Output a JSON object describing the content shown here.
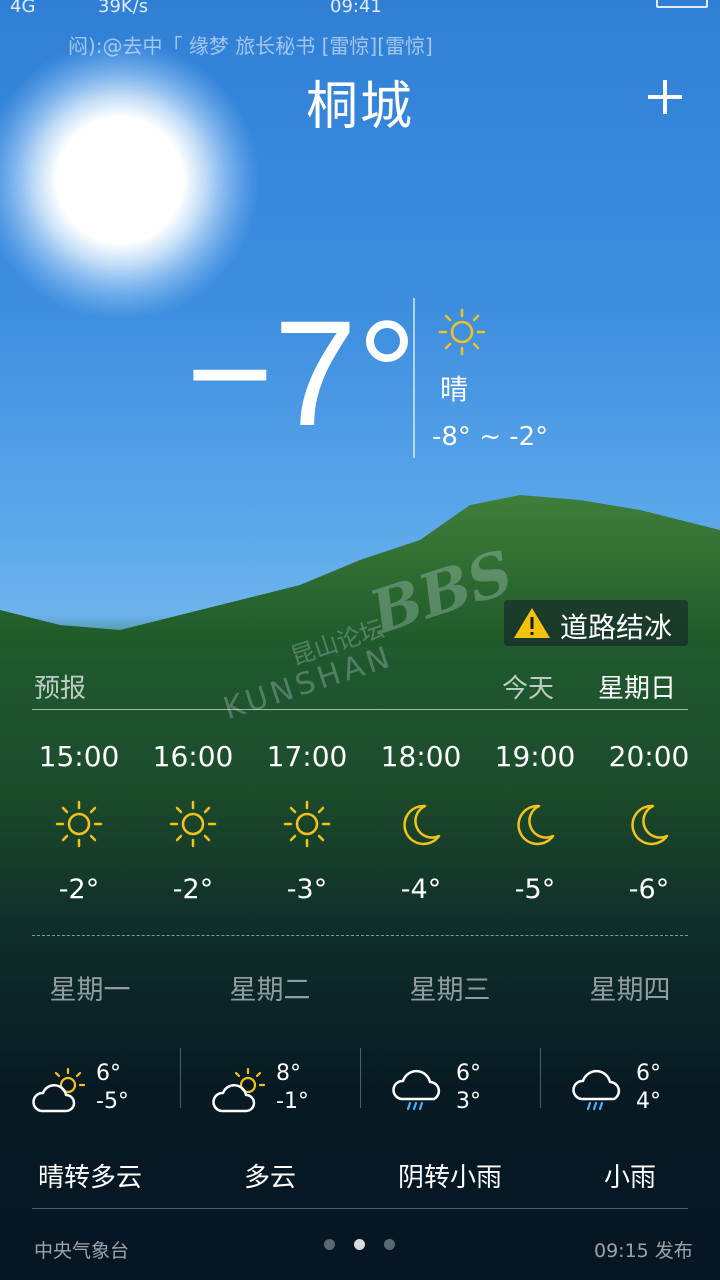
{
  "status_bar": {
    "network": "4G",
    "speed": "39K/s",
    "time": "09:41"
  },
  "notification": {
    "text": "闷):@去中「 缘梦 旅长秘书 [雷惊][雷惊]"
  },
  "header": {
    "city": "桐城"
  },
  "current": {
    "temperature": "−7°",
    "condition": "晴",
    "range": "-8° ~ -2°"
  },
  "alert": {
    "text": "道路结冰"
  },
  "watermark": {
    "line1": "BBS",
    "line2": "昆山论坛",
    "line3": "KUNSHAN"
  },
  "forecast": {
    "label": "预报",
    "today": "今天",
    "weekday": "星期日"
  },
  "hourly": [
    {
      "time": "15:00",
      "icon": "sun-icon",
      "temp": "-2°"
    },
    {
      "time": "16:00",
      "icon": "sun-icon",
      "temp": "-2°"
    },
    {
      "time": "17:00",
      "icon": "sun-icon",
      "temp": "-3°"
    },
    {
      "time": "18:00",
      "icon": "moon-icon",
      "temp": "-4°"
    },
    {
      "time": "19:00",
      "icon": "moon-icon",
      "temp": "-5°"
    },
    {
      "time": "20:00",
      "icon": "moon-icon",
      "temp": "-6°"
    }
  ],
  "daily": [
    {
      "day": "星期一",
      "icon": "partly-cloudy-icon",
      "high": "6°",
      "low": "-5°",
      "desc": "晴转多云"
    },
    {
      "day": "星期二",
      "icon": "partly-cloudy-icon",
      "high": "8°",
      "low": "-1°",
      "desc": "多云"
    },
    {
      "day": "星期三",
      "icon": "rain-cloud-icon",
      "high": "6°",
      "low": "3°",
      "desc": "阴转小雨"
    },
    {
      "day": "星期四",
      "icon": "rain-cloud-icon",
      "high": "6°",
      "low": "4°",
      "desc": "小雨"
    }
  ],
  "footer": {
    "source": "中央气象台",
    "published": "09:15 发布",
    "page_count": 3,
    "active_page": 2
  },
  "colors": {
    "icon_yellow": "#f3c21c",
    "alert_yellow": "#f4c20d",
    "sky": "#3f8fe0"
  }
}
